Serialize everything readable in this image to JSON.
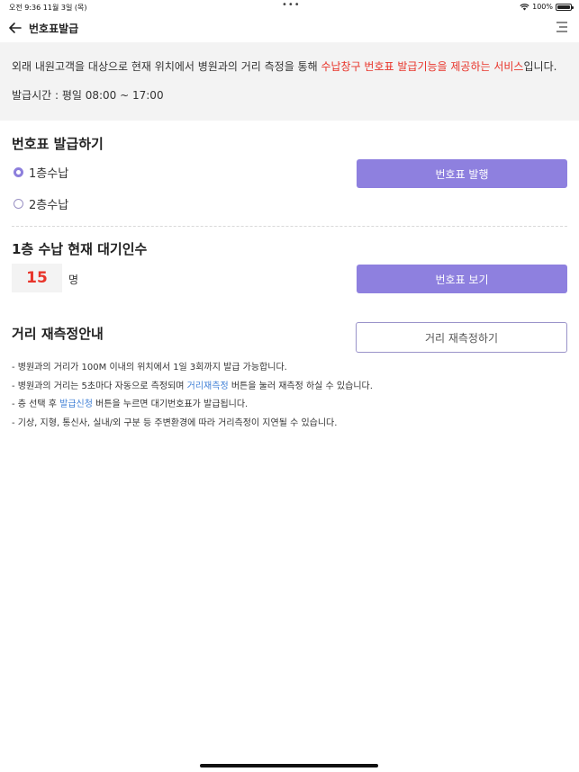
{
  "status_bar": {
    "time_date": "오전 9:36   11월 3일 (목)",
    "dots": "•••",
    "battery_text": "100%"
  },
  "header": {
    "title": "번호표발급",
    "back_icon": "arrow-left-icon",
    "menu_icon": "hamburger-menu-icon"
  },
  "info": {
    "intro_prefix": "외래 내원고객을 대상으로 현재 위치에서 병원과의 거리 측정을 통해 ",
    "intro_highlight": "수납창구 번호표 발급기능을 제공하는 서비스",
    "intro_suffix": "입니다.",
    "hours": "발급시간 : 평일 08:00 ~ 17:00"
  },
  "issue_section": {
    "title": "번호표 발급하기",
    "options": [
      {
        "label": "1층수납",
        "selected": true
      },
      {
        "label": "2층수납",
        "selected": false
      }
    ],
    "issue_button": "번호표 발행"
  },
  "waiting_section": {
    "title": "1층 수납 현재 대기인수",
    "count": "15",
    "unit": "명",
    "view_button": "번호표 보기"
  },
  "distance_section": {
    "title": "거리 재측정안내",
    "remeasure_button": "거리 재측정하기",
    "notes": [
      {
        "text": "- 병원과의 거리가 100M 이내의 위치에서 1일 3회까지 발급 가능합니다."
      },
      {
        "pre": "- 병원과의 거리는 5초마다 자동으로 측정되며 ",
        "link": "거리재측정",
        "post": " 버튼을 눌러 재측정 하실 수 있습니다."
      },
      {
        "pre": "- 층 선택 후 ",
        "link": "발급신청",
        "post": " 버튼을 누르면 대기번호표가 발급됩니다."
      },
      {
        "text": "- 기상, 지형, 통신사, 실내/외 구분 등 주변환경에 따라 거리측정이 지연될 수 있습니다."
      }
    ]
  },
  "colors": {
    "accent": "#8e80df",
    "highlight_red": "#e8342a",
    "link_blue": "#3f7fd6",
    "info_bg": "#f3f3f3"
  }
}
